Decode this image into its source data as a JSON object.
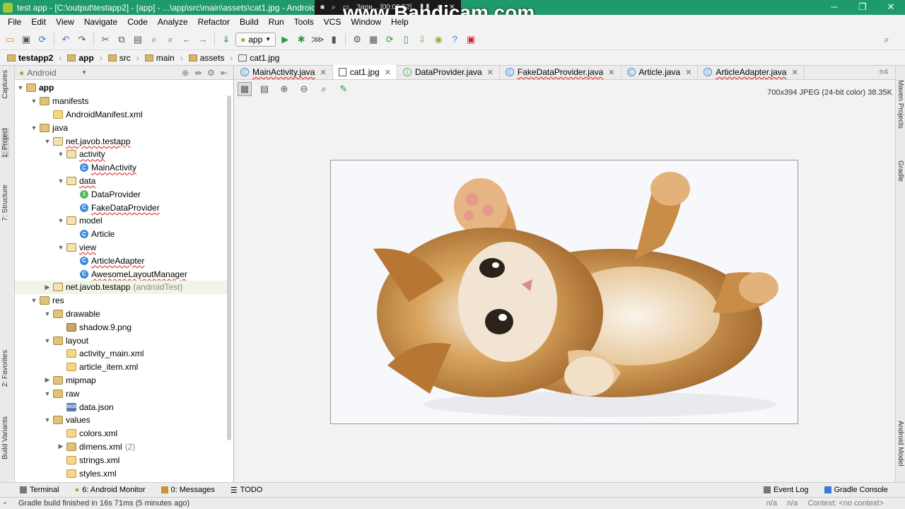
{
  "window": {
    "title": "test app - [C:\\output\\testapp2] - [app] - ...\\app\\src\\main\\assets\\cat1.jpg - Android St",
    "recorder_text": "Запи... [00:05:52]",
    "watermark": "www.Bandicam.com",
    "controls": [
      "─",
      "❐",
      "✕"
    ]
  },
  "menu": [
    "File",
    "Edit",
    "View",
    "Navigate",
    "Code",
    "Analyze",
    "Refactor",
    "Build",
    "Run",
    "Tools",
    "VCS",
    "Window",
    "Help"
  ],
  "toolbar": {
    "run_config": "app"
  },
  "breadcrumbs": [
    "testapp2",
    "app",
    "src",
    "main",
    "assets",
    "cat1.jpg"
  ],
  "left_strip": {
    "captures": "Captures",
    "project": "1: Project",
    "structure": "7: Structure",
    "favorites": "2: Favorites",
    "build_variants": "Build Variants"
  },
  "right_strip": {
    "maven": "Maven Projects",
    "gradle": "Gradle",
    "android_model": "Android Model"
  },
  "project_panel": {
    "view_mode": "Android",
    "tree": [
      {
        "label": "app",
        "indent": 0,
        "arrow": "▼",
        "icon": "folder",
        "bold": true
      },
      {
        "label": "manifests",
        "indent": 1,
        "arrow": "▼",
        "icon": "folder"
      },
      {
        "label": "AndroidManifest.xml",
        "indent": 2,
        "arrow": "",
        "icon": "xml"
      },
      {
        "label": "java",
        "indent": 1,
        "arrow": "▼",
        "icon": "folder"
      },
      {
        "label": "net.javob.testapp",
        "indent": 2,
        "arrow": "▼",
        "icon": "pkg",
        "sq": true
      },
      {
        "label": "activity",
        "indent": 3,
        "arrow": "▼",
        "icon": "pkg",
        "sq": true
      },
      {
        "label": "MainActivity",
        "indent": 4,
        "arrow": "",
        "icon": "cls",
        "sq": true
      },
      {
        "label": "data",
        "indent": 3,
        "arrow": "▼",
        "icon": "pkg",
        "sq": true
      },
      {
        "label": "DataProvider",
        "indent": 4,
        "arrow": "",
        "icon": "itf"
      },
      {
        "label": "FakeDataProvider",
        "indent": 4,
        "arrow": "",
        "icon": "cls",
        "sq": true
      },
      {
        "label": "model",
        "indent": 3,
        "arrow": "▼",
        "icon": "pkg"
      },
      {
        "label": "Article",
        "indent": 4,
        "arrow": "",
        "icon": "cls"
      },
      {
        "label": "view",
        "indent": 3,
        "arrow": "▼",
        "icon": "pkg",
        "sq": true
      },
      {
        "label": "ArticleAdapter",
        "indent": 4,
        "arrow": "",
        "icon": "cls",
        "sq": true
      },
      {
        "label": "AwesomeLayoutManager",
        "indent": 4,
        "arrow": "",
        "icon": "cls",
        "sq": true
      },
      {
        "label": "net.javob.testapp",
        "suffix": "(androidTest)",
        "indent": 2,
        "arrow": "▶",
        "icon": "pkg",
        "sel": true
      },
      {
        "label": "res",
        "indent": 1,
        "arrow": "▼",
        "icon": "folder"
      },
      {
        "label": "drawable",
        "indent": 2,
        "arrow": "▼",
        "icon": "folder"
      },
      {
        "label": "shadow.9.png",
        "indent": 3,
        "arrow": "",
        "icon": "img"
      },
      {
        "label": "layout",
        "indent": 2,
        "arrow": "▼",
        "icon": "folder"
      },
      {
        "label": "activity_main.xml",
        "indent": 3,
        "arrow": "",
        "icon": "xml"
      },
      {
        "label": "article_item.xml",
        "indent": 3,
        "arrow": "",
        "icon": "xml"
      },
      {
        "label": "mipmap",
        "indent": 2,
        "arrow": "▶",
        "icon": "folder"
      },
      {
        "label": "raw",
        "indent": 2,
        "arrow": "▼",
        "icon": "folder"
      },
      {
        "label": "data.json",
        "indent": 3,
        "arrow": "",
        "icon": "json"
      },
      {
        "label": "values",
        "indent": 2,
        "arrow": "▼",
        "icon": "folder"
      },
      {
        "label": "colors.xml",
        "indent": 3,
        "arrow": "",
        "icon": "xml"
      },
      {
        "label": "dimens.xml",
        "suffix": "(2)",
        "indent": 3,
        "arrow": "▶",
        "icon": "folder"
      },
      {
        "label": "strings.xml",
        "indent": 3,
        "arrow": "",
        "icon": "xml"
      },
      {
        "label": "styles.xml",
        "indent": 3,
        "arrow": "",
        "icon": "xml"
      }
    ]
  },
  "editor": {
    "tabs": [
      {
        "label": "MainActivity.java",
        "kind": "C",
        "sq": true
      },
      {
        "label": "cat1.jpg",
        "kind": "jpg",
        "active": true
      },
      {
        "label": "DataProvider.java",
        "kind": "I"
      },
      {
        "label": "FakeDataProvider.java",
        "kind": "C",
        "sq": true
      },
      {
        "label": "Article.java",
        "kind": "C"
      },
      {
        "label": "ArticleAdapter.java",
        "kind": "C",
        "sq": true
      }
    ],
    "tab_menu": "≡4",
    "image_info": "700x394 JPEG (24-bit color) 38.35K"
  },
  "bottom_tabs": {
    "terminal": "Terminal",
    "android_monitor": "6: Android Monitor",
    "messages": "0: Messages",
    "todo": "TODO",
    "event_log": "Event Log",
    "gradle_console": "Gradle Console"
  },
  "status": {
    "message": "Gradle build finished in 16s 71ms (5 minutes ago)",
    "na1": "n/a",
    "na2": "n/a",
    "context": "Context: <no context>"
  }
}
